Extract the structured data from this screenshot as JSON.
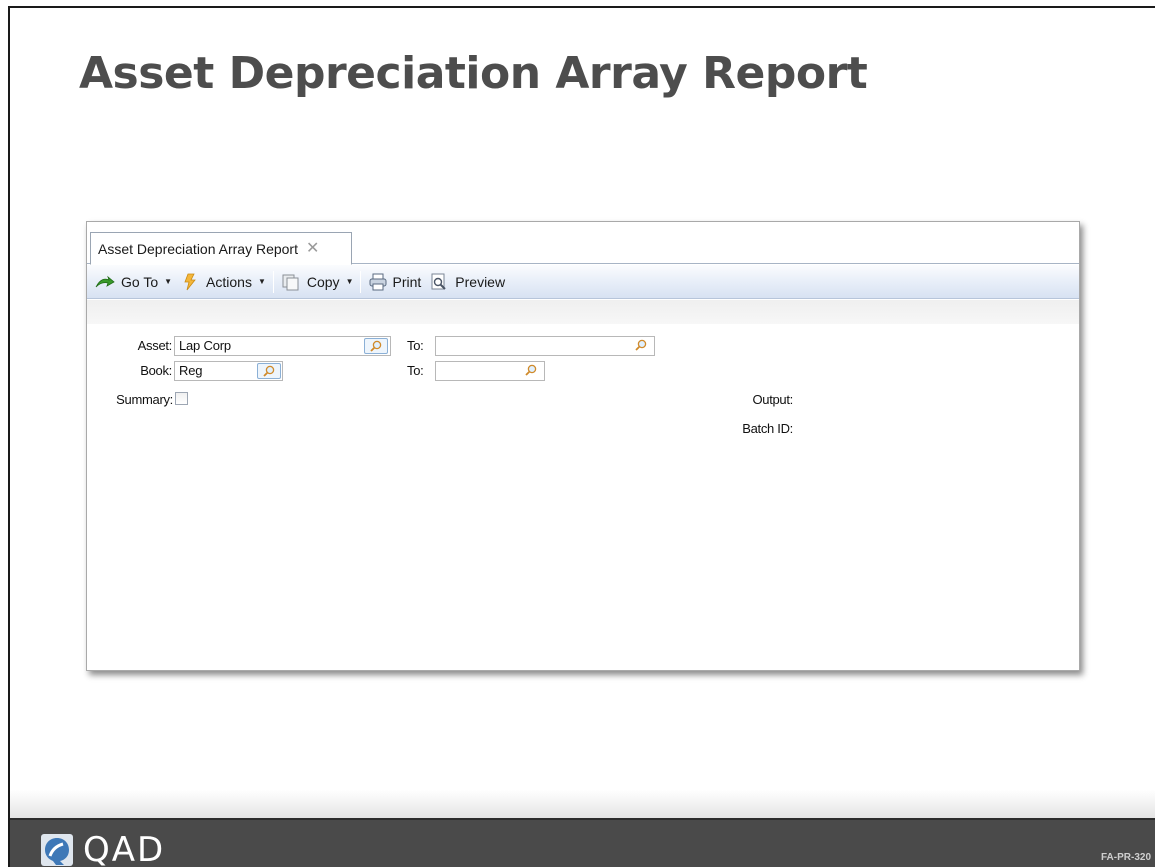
{
  "slide": {
    "title": "Asset Depreciation Array Report",
    "code": "FA-PR-320",
    "logo_text": "QAD"
  },
  "window": {
    "tab_label": "Asset Depreciation Array Report",
    "tab_close": "✕"
  },
  "toolbar": {
    "goto_label": "Go To",
    "actions_label": "Actions",
    "copy_label": "Copy",
    "print_label": "Print",
    "preview_label": "Preview"
  },
  "form": {
    "asset_label": "Asset:",
    "asset_value": "Lap Corp",
    "asset_to_label": "To:",
    "asset_to_value": "",
    "book_label": "Book:",
    "book_value": "Reg",
    "book_to_label": "To:",
    "book_to_value": "",
    "summary_label": "Summary:",
    "summary_checked": false,
    "output_label": "Output:",
    "batch_label": "Batch ID:"
  },
  "icons": {
    "goto": "green-arrow-icon",
    "actions": "lightning-icon",
    "copy": "copy-icon",
    "print": "printer-icon",
    "preview": "preview-icon",
    "lookup": "magnifier-icon"
  },
  "colors": {
    "title": "#4d4d4d",
    "footer": "#4a4a4a",
    "toolbar": "#e6edf8"
  }
}
